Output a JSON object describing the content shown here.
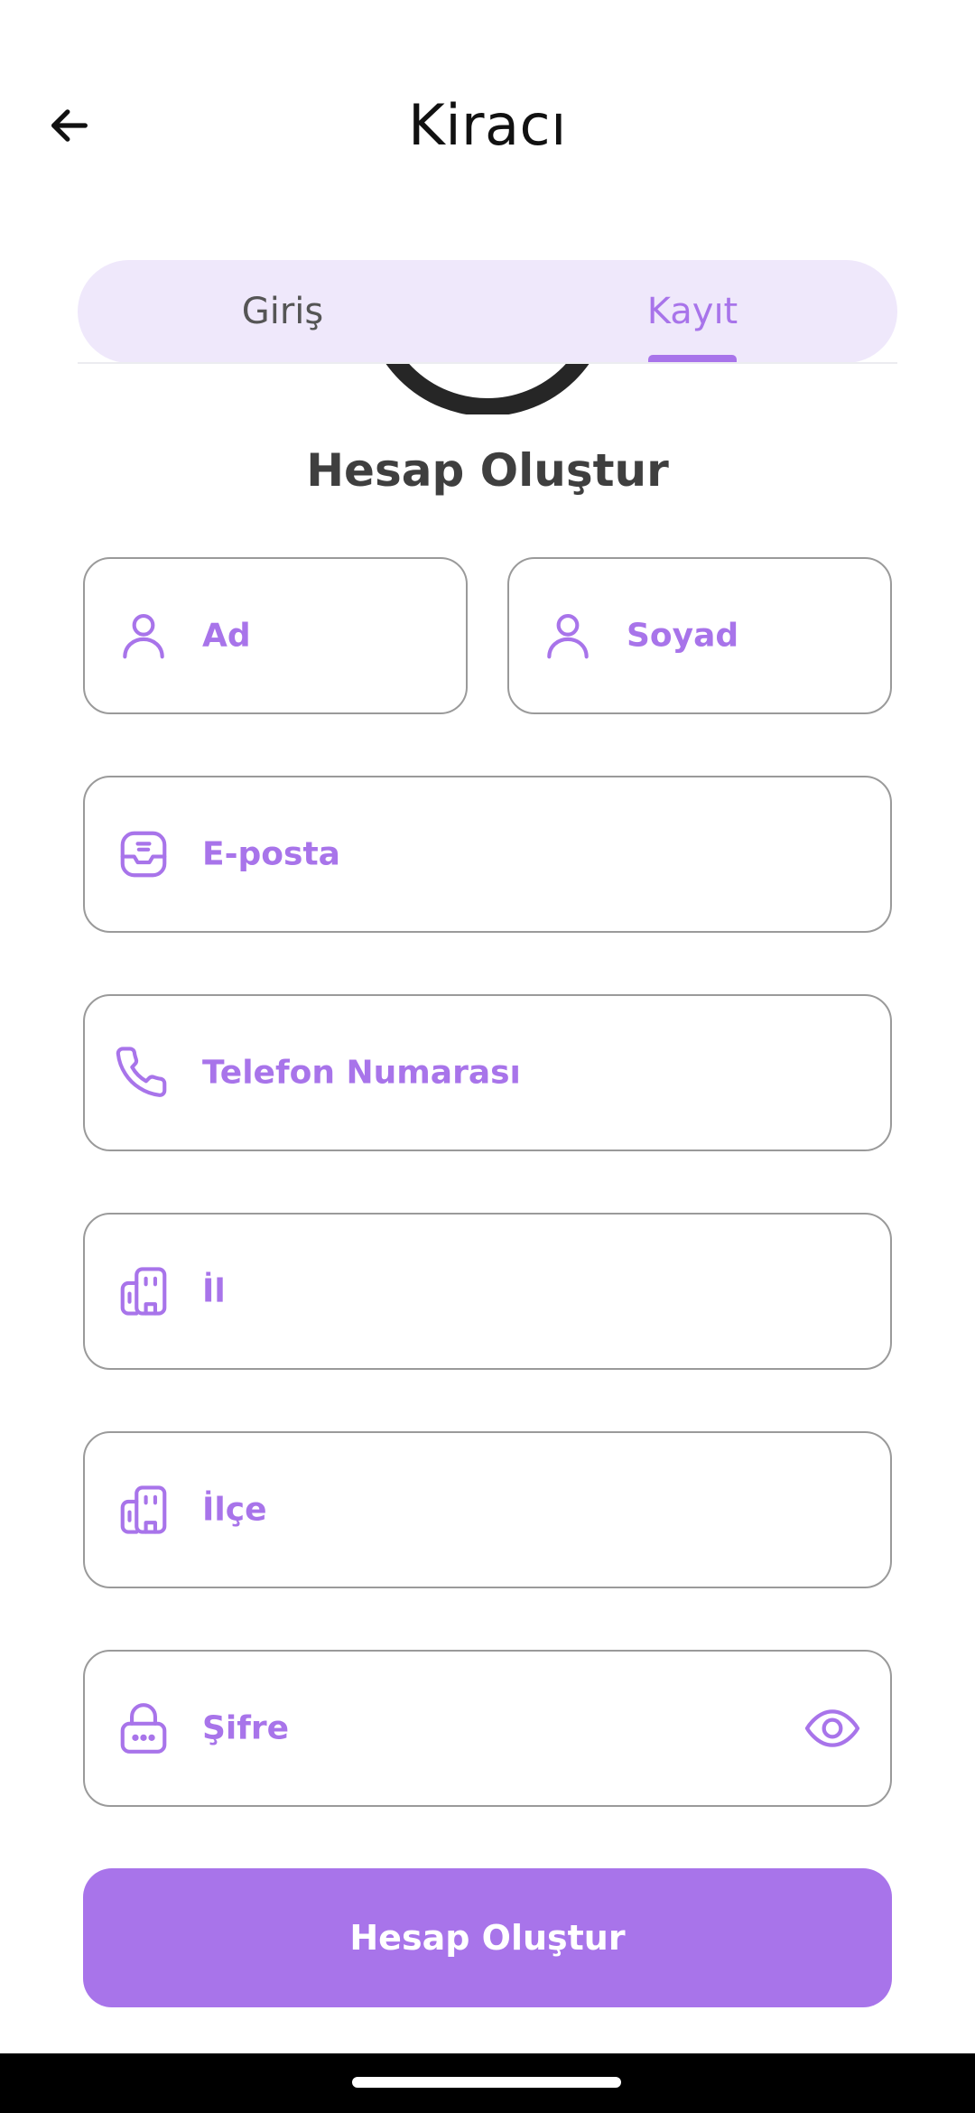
{
  "header": {
    "title": "Kiracı",
    "back_icon": "arrow-left-icon"
  },
  "tabs": [
    {
      "label": "Giriş",
      "active": false
    },
    {
      "label": "Kayıt",
      "active": true
    }
  ],
  "form": {
    "heading": "Hesap Oluştur",
    "fields": {
      "first_name": {
        "placeholder": "Ad",
        "value": "",
        "icon": "user-icon"
      },
      "last_name": {
        "placeholder": "Soyad",
        "value": "",
        "icon": "user-icon"
      },
      "email": {
        "placeholder": "E-posta",
        "value": "",
        "icon": "inbox-icon"
      },
      "phone": {
        "placeholder": "Telefon Numarası",
        "value": "",
        "icon": "phone-icon"
      },
      "city": {
        "placeholder": "İl",
        "value": "",
        "icon": "building-icon"
      },
      "district": {
        "placeholder": "İlçe",
        "value": "",
        "icon": "building-icon"
      },
      "password": {
        "placeholder": "Şifre",
        "value": "",
        "icon": "lock-icon",
        "toggle_icon": "eye-icon"
      }
    },
    "submit_label": "Hesap Oluştur"
  },
  "colors": {
    "accent": "#a874ea",
    "tab_background": "#efe8fb",
    "field_border": "#9a9a9a",
    "heading": "#3f3f3f"
  }
}
